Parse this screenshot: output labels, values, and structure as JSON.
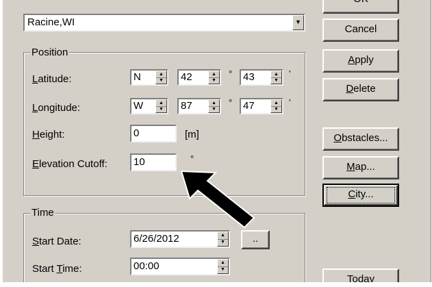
{
  "location_combo": {
    "value": "Racine,WI"
  },
  "buttons": {
    "ok": "OK",
    "cancel": "Cancel",
    "apply_pre": "",
    "apply_u": "A",
    "apply_post": "pply",
    "delete_pre": "",
    "delete_u": "D",
    "delete_post": "elete",
    "obstacles_pre": "",
    "obstacles_u": "O",
    "obstacles_post": "bstacles...",
    "map_pre": "",
    "map_u": "M",
    "map_post": "ap...",
    "city_pre": "",
    "city_u": "C",
    "city_post": "ity...",
    "today": "Today",
    "date_picker": ".."
  },
  "position": {
    "title": "Position",
    "latitude_label_u": "L",
    "latitude_label_rest": "atitude:",
    "latitude": {
      "hemisphere": "N",
      "degrees": "42",
      "minutes": "43"
    },
    "longitude_label_u": "L",
    "longitude_label_rest": "ongitude:",
    "longitude": {
      "hemisphere": "W",
      "degrees": "87",
      "minutes": "47"
    },
    "degree_mark": "°",
    "minute_mark": "'",
    "height_label_u": "H",
    "height_label_rest": "eight:",
    "height_value": "0",
    "height_unit": "[m]",
    "elevation_label_u": "E",
    "elevation_label_rest": "levation Cutoff:",
    "elevation_value": "10",
    "elevation_unit": "°"
  },
  "time": {
    "title": "Time",
    "start_date_label_u": "S",
    "start_date_label_rest": "tart Date:",
    "start_date_value": "6/26/2012",
    "start_time_label_pre": "Start ",
    "start_time_label_u": "T",
    "start_time_label_rest": "ime:",
    "start_time_value": "00:00"
  }
}
